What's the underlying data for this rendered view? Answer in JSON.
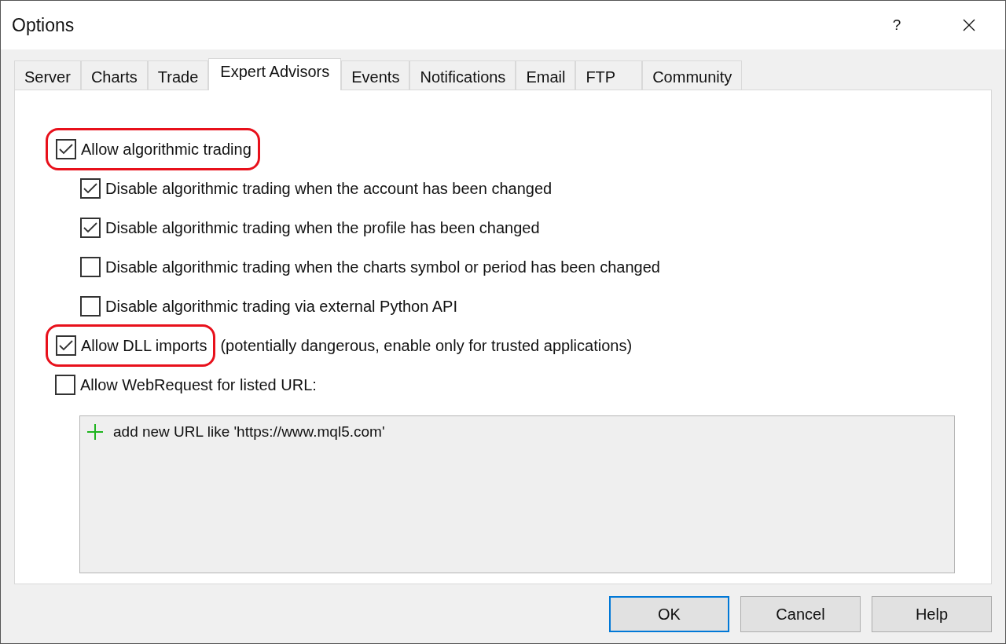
{
  "window": {
    "title": "Options",
    "help_glyph": "?"
  },
  "tabs": [
    {
      "label": "Server",
      "selected": false
    },
    {
      "label": "Charts",
      "selected": false
    },
    {
      "label": "Trade",
      "selected": false
    },
    {
      "label": "Expert Advisors",
      "selected": true
    },
    {
      "label": "Events",
      "selected": false
    },
    {
      "label": "Notifications",
      "selected": false
    },
    {
      "label": "Email",
      "selected": false
    },
    {
      "label": "FTP",
      "selected": false
    },
    {
      "label": "Community",
      "selected": false
    }
  ],
  "options": [
    {
      "label": "Allow algorithmic trading",
      "checked": true,
      "highlighted": true,
      "children": [
        {
          "label": "Disable algorithmic trading when the account has been changed",
          "checked": true,
          "highlighted": false
        },
        {
          "label": "Disable algorithmic trading when the profile has been changed",
          "checked": true,
          "highlighted": false
        },
        {
          "label": "Disable algorithmic trading when the charts symbol or period has been changed",
          "checked": false,
          "highlighted": false
        },
        {
          "label": "Disable algorithmic trading via external Python API",
          "checked": false,
          "highlighted": false
        }
      ]
    },
    {
      "label": "Allow DLL imports",
      "note": "(potentially dangerous, enable only for trusted applications)",
      "checked": true,
      "highlighted": true
    },
    {
      "label": "Allow WebRequest for listed URL:",
      "checked": false,
      "highlighted": false
    }
  ],
  "url_list": {
    "add_entry": "add new URL like 'https://www.mql5.com'"
  },
  "buttons": [
    {
      "label": "OK",
      "default": true
    },
    {
      "label": "Cancel",
      "default": false
    },
    {
      "label": "Help",
      "default": false
    }
  ]
}
